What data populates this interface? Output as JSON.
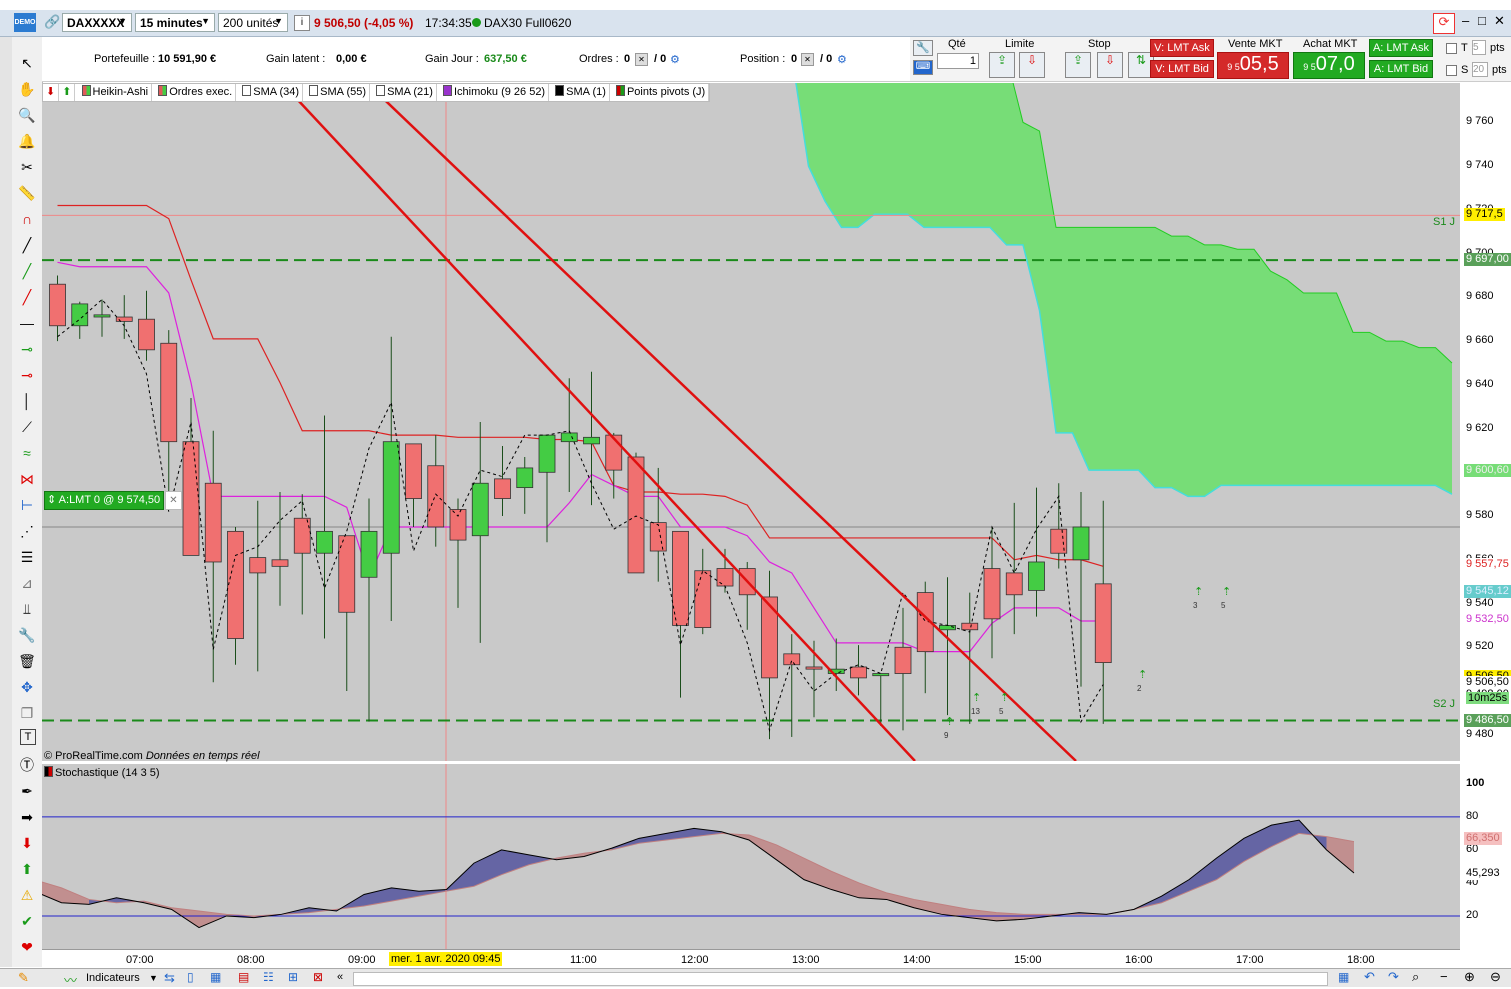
{
  "toolbar": {
    "instrument": "DAXXXXX",
    "timeframe": "15 minutes",
    "units": "200 unités",
    "price_change": "9 506,50 (-4,05 %)",
    "time": "17:34:35",
    "contract": "DAX30 Full0620",
    "demo": "DEMO"
  },
  "account": {
    "portefeuille_label": "Portefeuille :",
    "portefeuille_value": "10 591,90 €",
    "gain_latent_label": "Gain latent :",
    "gain_latent_value": "0,00 €",
    "gain_jour_label": "Gain Jour :",
    "gain_jour_value": "637,50 €",
    "ordres_label": "Ordres :",
    "ordres_value": "0",
    "ordres_value2": "/ 0",
    "position_label": "Position :",
    "position_value": "0",
    "position_value2": "/ 0"
  },
  "order_panel": {
    "qty_label": "Qté",
    "qty_value": "1",
    "limite_label": "Limite",
    "stop_label": "Stop",
    "v_lmt_ask": "V: LMT Ask",
    "v_lmt_bid": "V: LMT Bid",
    "vente_mkt_label": "Vente MKT",
    "vente_small": "9 5",
    "vente_big": "05,5",
    "achat_mkt_label": "Achat MKT",
    "achat_small": "9 5",
    "achat_big": "07,0",
    "a_lmt_ask": "A: LMT Ask",
    "a_lmt_bid": "A: LMT Bid",
    "t_label": "T",
    "t_value": "5",
    "t_unit": "pts",
    "s_label": "S",
    "s_value": "20",
    "s_unit": "pts"
  },
  "legend": [
    {
      "label": "Heikin-Ashi",
      "color": "#e05a5a",
      "color2": "#44cc44"
    },
    {
      "label": "Ordres exec.",
      "color": "#e05a5a",
      "color2": "#44cc44"
    },
    {
      "label": "SMA (34)",
      "color": "#ffffff"
    },
    {
      "label": "SMA (55)",
      "color": "#ffffff"
    },
    {
      "label": "SMA (21)",
      "color": "#ffffff"
    },
    {
      "label": "Ichimoku (9 26 52)",
      "color": "#9933cc"
    },
    {
      "label": "SMA (1)",
      "color": "#000000"
    },
    {
      "label": "Points pivots (J)",
      "color": "#333333"
    }
  ],
  "chart_labels": {
    "copyright": "© ProRealTime.com",
    "realtime": "Données en temps réel",
    "order_tag": "A:LMT  0 @ 9 574,50",
    "s1": "S1 J",
    "s2": "S2 J",
    "stoch_title": "Stochastique (14 3 5)",
    "cursor_time": "mer. 1 avr. 2020 09:45",
    "timer": "10m25s"
  },
  "bottom": {
    "indicateurs": "Indicateurs"
  },
  "chart_data": [
    {
      "type": "candlestick",
      "title": "DAXXXXX",
      "ylim": [
        9468,
        9778
      ],
      "yticks": [
        9760,
        9740,
        9720,
        9700,
        9680,
        9660,
        9640,
        9620,
        9600,
        9580,
        9560,
        9540,
        9520,
        9500,
        9480
      ],
      "xticks": [
        "07:00",
        "08:00",
        "09:00",
        "10:00",
        "11:00",
        "12:00",
        "13:00",
        "14:00",
        "15:00",
        "16:00",
        "17:00",
        "18:00"
      ],
      "candles": [
        [
          9686,
          9690,
          9660,
          9667
        ],
        [
          9667,
          9678,
          9661,
          9677
        ],
        [
          9671,
          9679,
          9662,
          9672
        ],
        [
          9671,
          9681,
          9661,
          9669
        ],
        [
          9670,
          9683,
          9651,
          9656
        ],
        [
          9659,
          9665,
          9585,
          9614
        ],
        [
          9614,
          9634,
          9574,
          9562
        ],
        [
          9595,
          9619,
          9504,
          9559
        ],
        [
          9573,
          9575,
          9512,
          9524
        ],
        [
          9561,
          9587,
          9509,
          9554
        ],
        [
          9560,
          9591,
          9539,
          9557
        ],
        [
          9579,
          9590,
          9535,
          9563
        ],
        [
          9563,
          9626,
          9524,
          9573
        ],
        [
          9571,
          9571,
          9500,
          9536
        ],
        [
          9552,
          9588,
          9486,
          9573
        ],
        [
          9563,
          9662,
          9532,
          9614
        ],
        [
          9613,
          9613,
          9575,
          9588
        ],
        [
          9603,
          9617,
          9566,
          9575
        ],
        [
          9583,
          9588,
          9538,
          9569
        ],
        [
          9571,
          9623,
          9522,
          9595
        ],
        [
          9597,
          9612,
          9580,
          9588
        ],
        [
          9593,
          9607,
          9581,
          9602
        ],
        [
          9600,
          9611,
          9568,
          9617
        ],
        [
          9614,
          9643,
          9591,
          9618
        ],
        [
          9613,
          9646,
          9585,
          9616
        ],
        [
          9617,
          9618,
          9588,
          9601
        ],
        [
          9607,
          9609,
          9560,
          9554
        ],
        [
          9577,
          9602,
          9550,
          9564
        ],
        [
          9573,
          9572,
          9497,
          9530
        ],
        [
          9555,
          9565,
          9526,
          9529
        ],
        [
          9556,
          9565,
          9545,
          9548
        ],
        [
          9556,
          9559,
          9528,
          9544
        ],
        [
          9543,
          9555,
          9478,
          9506
        ],
        [
          9517,
          9526,
          9479,
          9512
        ],
        [
          9511,
          9523,
          9488,
          9510
        ],
        [
          9508,
          9524,
          9500,
          9510
        ],
        [
          9511,
          9521,
          9498,
          9506
        ],
        [
          9507,
          9508,
          9484,
          9508
        ],
        [
          9520,
          9538,
          9482,
          9508
        ],
        [
          9545,
          9550,
          9499,
          9518
        ],
        [
          9528,
          9552,
          9489,
          9530
        ],
        [
          9531,
          9545,
          9485,
          9528
        ],
        [
          9556,
          9575,
          9515,
          9533
        ],
        [
          9554,
          9586,
          9526,
          9544
        ],
        [
          9546,
          9593,
          9534,
          9559
        ],
        [
          9574,
          9595,
          9556,
          9563
        ],
        [
          9560,
          9591,
          9502,
          9575
        ],
        [
          9549,
          9587,
          9485,
          9513
        ]
      ],
      "series": [
        {
          "name": "SMA (34)",
          "color": "#dd2222",
          "values": [
            9722,
            9722,
            9722,
            9722,
            9722,
            9716,
            9688,
            9661,
            9661,
            9661,
            9641,
            9619,
            9619,
            9619,
            9619,
            9617,
            9617,
            9617,
            9616,
            9616,
            9616,
            9616,
            9615,
            9615,
            9614,
            9594,
            9591,
            9591,
            9590,
            9590,
            9589,
            9585,
            9570,
            9570,
            9570,
            9570,
            9570,
            9570,
            9570,
            9570,
            9570,
            9570,
            9570,
            9560,
            9562,
            9560,
            9560,
            9557
          ]
        },
        {
          "name": "SMA (55)",
          "color": "#dd22dd",
          "values": [
            9696,
            9694,
            9694,
            9694,
            9694,
            9682,
            9641,
            9589,
            9589,
            9589,
            9589,
            9589,
            9589,
            9584,
            9552,
            9575,
            9575,
            9575,
            9575,
            9575,
            9575,
            9575,
            9575,
            9586,
            9599,
            9594,
            9589,
            9589,
            9575,
            9575,
            9575,
            9571,
            9559,
            9554,
            9538,
            9522,
            9522,
            9522,
            9522,
            9518,
            9518,
            9518,
            9531,
            9538,
            9538,
            9538,
            9532,
            9532
          ]
        },
        {
          "name": "SMA (1)",
          "color": "#000000",
          "values": [
            9662,
            9670,
            9679,
            9667,
            9645,
            9582,
            9623,
            9519,
            9562,
            9566,
            9578,
            9587,
            9547,
            9573,
            9611,
            9632,
            9564,
            9590,
            9580,
            9601,
            9598,
            9617,
            9617,
            9619,
            9595,
            9574,
            9580,
            9576,
            9521,
            9555,
            9548,
            9522,
            9482,
            9514,
            9500,
            9508,
            9512,
            9508,
            9545,
            9532,
            9530,
            9527,
            9575,
            9554,
            9574,
            9589,
            9486,
            9503
          ]
        }
      ],
      "ichimoku_cloud": {
        "top": [
          9790,
          9790,
          9790,
          9790,
          9790,
          9790,
          9790,
          9790,
          9790,
          9790,
          9790,
          9790,
          9790,
          9790,
          9790,
          9790,
          9790,
          9790,
          9790,
          9790,
          9790,
          9790,
          9790,
          9790,
          9790,
          9790,
          9790,
          9790,
          9790,
          9790,
          9790,
          9790,
          9790,
          9790,
          9790,
          9790,
          9790,
          9790,
          9790,
          9790,
          9790,
          9790,
          9790,
          9790,
          9790,
          9790,
          9790,
          9790,
          9790,
          9790,
          9790,
          9790,
          9790,
          9790,
          9790,
          9790,
          9790,
          9790,
          9790,
          9790,
          9790
        ],
        "bottom": [
          9790,
          9790,
          9790,
          9790,
          9790,
          9790,
          9790,
          9790,
          9790,
          9790,
          9790,
          9790,
          9790,
          9790,
          9790,
          9790,
          9790,
          9790,
          9790,
          9790,
          9790,
          9740,
          9724,
          9712,
          9712,
          9718,
          9718,
          9718,
          9712,
          9712,
          9712,
          9712,
          9712,
          9704,
          9704,
          9674,
          9618,
          9618,
          9601,
          9601,
          9601,
          9601,
          9593,
          9593,
          9589,
          9589,
          9594,
          9594,
          9594,
          9594,
          9594,
          9594,
          9594,
          9594,
          9594,
          9594,
          9594,
          9594,
          9594,
          9594,
          9590
        ],
        "upper": [
          9790,
          9790,
          9790,
          9790,
          9790,
          9790,
          9790,
          9790,
          9790,
          9790,
          9790,
          9790,
          9790,
          9790,
          9790,
          9790,
          9790,
          9790,
          9790,
          9790,
          9790,
          9790,
          9790,
          9790,
          9790,
          9790,
          9790,
          9790,
          9790,
          9790,
          9790,
          9790,
          9790,
          9790,
          9760,
          9756,
          9712,
          9712,
          9712,
          9712,
          9712,
          9712,
          9712,
          9708,
          9708,
          9704,
          9704,
          9702,
          9702,
          9692,
          9688,
          9682,
          9682,
          9682,
          9664,
          9664,
          9660,
          9660,
          9657,
          9657,
          9650
        ]
      },
      "levels": [
        {
          "name": "S1 J",
          "value": 9697.0,
          "label": "9 697,00"
        },
        {
          "name": "S2 J",
          "value": 9486.5,
          "label": "9 486,50"
        }
      ],
      "price_labels": [
        {
          "value": 9717.5,
          "label": "9 717,5",
          "bg": "#ffee00",
          "fg": "#000"
        },
        {
          "value": 9697.0,
          "label": "9 697,00",
          "bg": "#5aa05a",
          "fg": "#fff"
        },
        {
          "value": 9600.6,
          "label": "9 600,60",
          "bg": "#77dd77",
          "fg": "#eee"
        },
        {
          "value": 9557.75,
          "label": "9 557,75",
          "bg": "#ffffff",
          "fg": "#dd2222"
        },
        {
          "value": 9545.1,
          "label": "9 545,12",
          "bg": "#66cccc",
          "fg": "#ddeeff"
        },
        {
          "value": 9532.5,
          "label": "9 532,50",
          "bg": "#ffffff",
          "fg": "#cc33cc"
        },
        {
          "value": 9506.5,
          "label": "9 506,50",
          "bg": "#ffee00",
          "fg": "#000"
        },
        {
          "value": 9503.5,
          "label": "9 506,50",
          "bg": "#ffffff",
          "fg": "#000"
        },
        {
          "value": 9498.0,
          "label": "9 498,00",
          "bg": "#ffffff",
          "fg": "#000"
        },
        {
          "value": 9486.5,
          "label": "9 486,50",
          "bg": "#5aa05a",
          "fg": "#fff"
        }
      ],
      "order_level": 9574.5,
      "current_price_line": 9575
    },
    {
      "type": "area",
      "title": "Stochastique (14 3 5)",
      "ylim": [
        0,
        112
      ],
      "yticks": [
        100,
        80,
        60,
        40,
        20
      ],
      "bands": [
        80,
        20
      ],
      "series": [
        {
          "name": "%K",
          "color": "#000000",
          "values": [
            35,
            28,
            27,
            31,
            28,
            24,
            13,
            20,
            19,
            21,
            25,
            23,
            33,
            37,
            35,
            36,
            52,
            60,
            57,
            54,
            56,
            61,
            67,
            70,
            73,
            71,
            66,
            54,
            42,
            36,
            31,
            30,
            25,
            21,
            19,
            17,
            18,
            20,
            22,
            21,
            24,
            32,
            42,
            55,
            67,
            75,
            78,
            60,
            46
          ]
        },
        {
          "name": "%D",
          "color": "#c08080",
          "values": [
            42,
            37,
            30,
            28,
            29,
            25,
            23,
            21,
            20,
            21,
            22,
            24,
            26,
            29,
            32,
            35,
            38,
            45,
            51,
            55,
            58,
            60,
            64,
            66,
            68,
            70,
            69,
            63,
            55,
            47,
            40,
            34,
            30,
            27,
            24,
            22,
            21,
            21,
            21,
            21,
            24,
            28,
            35,
            42,
            53,
            62,
            70,
            68,
            65
          ]
        },
        {
          "name": "66,350",
          "label": "66,350"
        },
        {
          "name": "45,293",
          "label": "45,293"
        }
      ]
    }
  ]
}
